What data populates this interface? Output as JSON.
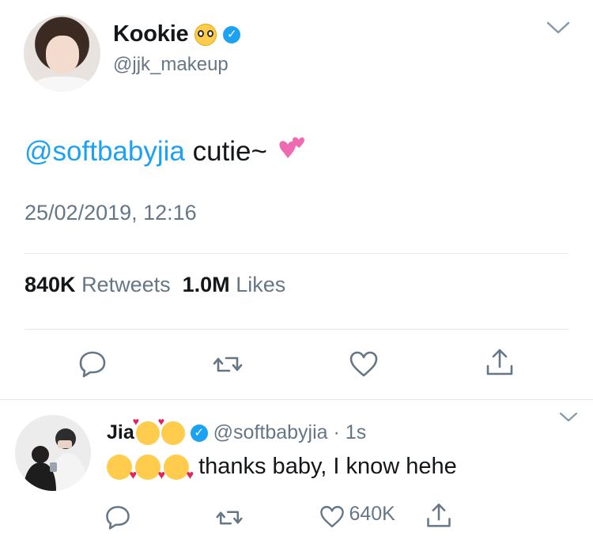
{
  "tweet": {
    "author_name": "Kookie",
    "author_handle": "@jjk_makeup",
    "mention": "@softbabyjia",
    "text": " cutie~",
    "timestamp": "25/02/2019, 12:16",
    "retweets_count": "840K",
    "retweets_label": "Retweets",
    "likes_count": "1.0M",
    "likes_label": "Likes"
  },
  "reply": {
    "author_name": "Jia",
    "author_handle": "@softbabyjia",
    "time": "1s",
    "separator": " · ",
    "text": "thanks baby, I know hehe",
    "like_count": "640K"
  },
  "colors": {
    "accent": "#1da1f2",
    "secondary_text": "#657786",
    "divider": "#e1e8ed"
  },
  "icons": [
    "chevron-down-icon",
    "reply-icon",
    "retweet-icon",
    "heart-icon",
    "share-icon",
    "verified-badge-icon"
  ]
}
